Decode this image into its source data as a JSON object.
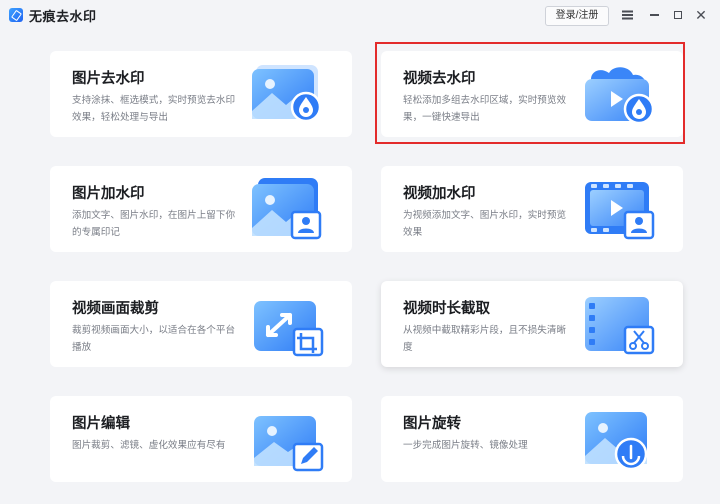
{
  "app": {
    "title": "无痕去水印"
  },
  "titlebar": {
    "login_label": "登录/注册",
    "menu_icon": "menu-icon",
    "minimize_icon": "minimize-icon",
    "maximize_icon": "maximize-icon",
    "close_icon": "close-icon",
    "close_glyph": "✕"
  },
  "cards": [
    {
      "title": "图片去水印",
      "desc": "支持涂抹、框选模式，实时预览去水印效果，轻松处理与导出",
      "icon": "image-remove-watermark-icon"
    },
    {
      "title": "视频去水印",
      "desc": "轻松添加多组去水印区域，实时预览效果，一键快速导出",
      "icon": "video-remove-watermark-icon",
      "highlighted": true
    },
    {
      "title": "图片加水印",
      "desc": "添加文字、图片水印，在图片上留下你的专属印记",
      "icon": "image-add-watermark-icon"
    },
    {
      "title": "视频加水印",
      "desc": "为视频添加文字、图片水印，实时预览效果",
      "icon": "video-add-watermark-icon"
    },
    {
      "title": "视频画面裁剪",
      "desc": "裁剪视频画面大小，以适合在各个平台播放",
      "icon": "video-crop-icon"
    },
    {
      "title": "视频时长截取",
      "desc": "从视频中截取精彩片段，且不损失清晰度",
      "icon": "video-trim-icon"
    },
    {
      "title": "图片编辑",
      "desc": "图片裁剪、滤镜、虚化效果应有尽有",
      "icon": "image-edit-icon"
    },
    {
      "title": "图片旋转",
      "desc": "一步完成图片旋转、镜像处理",
      "icon": "image-rotate-icon"
    }
  ],
  "colors": {
    "accent_blue": "#2f7cf6",
    "highlight_red": "#e32b2b",
    "background": "#f3f4f7"
  }
}
